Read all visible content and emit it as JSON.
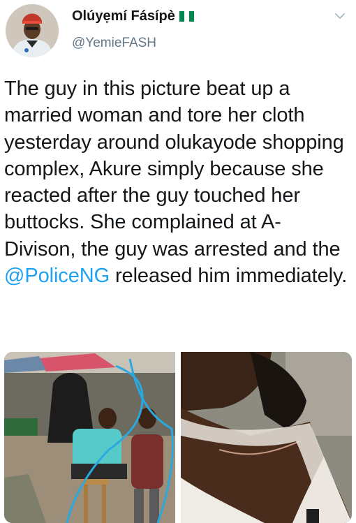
{
  "tweet": {
    "author": {
      "display_name": "Olúyẹmí Fásípè",
      "handle": "@YemieFASH",
      "flag_icon": "nigeria-flag-icon",
      "flag_colors": [
        "#008751",
        "#ffffff",
        "#008751"
      ]
    },
    "menu_icon": "chevron-down-icon",
    "text_segments": {
      "before_mention": "The guy in this picture beat up a married woman and tore her cloth yesterday around olukayode shopping complex, Akure simply because she reacted after the guy touched her buttocks. She complained at A-Divison, the guy was arrested and the ",
      "mention": "@PoliceNG",
      "after_mention": " released him immediately."
    },
    "media": [
      {
        "kind": "photo",
        "subject": "market-scene-photo"
      },
      {
        "kind": "photo",
        "subject": "neck-injury-photo"
      }
    ],
    "colors": {
      "text": "#14171a",
      "secondary": "#657786",
      "link": "#1da1f2"
    }
  }
}
